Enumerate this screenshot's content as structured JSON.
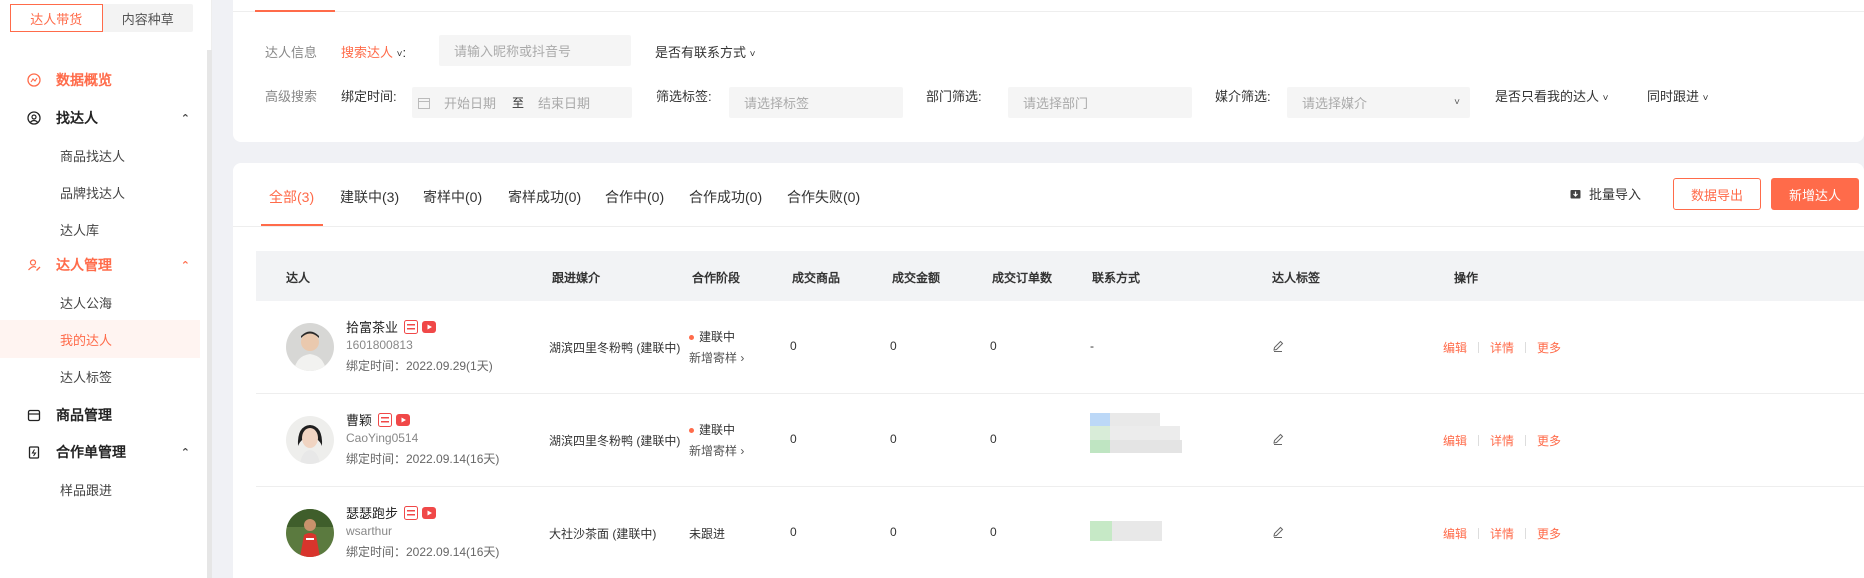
{
  "sidebar": {
    "top_tabs": [
      "达人带货",
      "内容种草"
    ],
    "groups": [
      {
        "label": "数据概览"
      },
      {
        "label": "找达人",
        "items": [
          "商品找达人",
          "品牌找达人",
          "达人库"
        ]
      },
      {
        "label": "达人管理",
        "items": [
          "达人公海",
          "我的达人",
          "达人标签"
        ]
      },
      {
        "label": "商品管理"
      },
      {
        "label": "合作单管理",
        "items": [
          "样品跟进"
        ]
      }
    ]
  },
  "filters": {
    "row1": {
      "label": "达人信息",
      "search_type": "搜索达人",
      "search_placeholder": "请输入昵称或抖音号",
      "contact_dropdown": "是否有联系方式"
    },
    "row2": {
      "label": "高级搜索",
      "bind_time_label": "绑定时间:",
      "start_placeholder": "开始日期",
      "range_sep": "至",
      "end_placeholder": "结束日期",
      "tag_label": "筛选标签:",
      "tag_placeholder": "请选择标签",
      "dept_label": "部门筛选:",
      "dept_placeholder": "请选择部门",
      "media_label": "媒介筛选:",
      "media_placeholder": "请选择媒介",
      "mine_dropdown": "是否只看我的达人",
      "sync_dropdown": "同时跟进"
    }
  },
  "status_tabs": [
    "全部(3)",
    "建联中(3)",
    "寄样中(0)",
    "寄样成功(0)",
    "合作中(0)",
    "合作成功(0)",
    "合作失败(0)"
  ],
  "actions": {
    "import": "批量导入",
    "export": "数据导出",
    "add": "新增达人"
  },
  "table": {
    "headers": [
      "达人",
      "跟进媒介",
      "合作阶段",
      "成交商品",
      "成交金额",
      "成交订单数",
      "联系方式",
      "达人标签",
      "操作"
    ],
    "rows": [
      {
        "name": "拾富茶业",
        "handle": "1601800813",
        "bind_time": "绑定时间：2022.09.29(1天)",
        "media": "湖滨四里冬粉鸭 (建联中)",
        "stage": "建联中",
        "stage_action": "新增寄样 ›",
        "goods": "0",
        "amount": "0",
        "orders": "0",
        "contact": "-"
      },
      {
        "name": "曹颖",
        "handle": "CaoYing0514",
        "bind_time": "绑定时间：2022.09.14(16天)",
        "media": "湖滨四里冬粉鸭 (建联中)",
        "stage": "建联中",
        "stage_action": "新增寄样 ›",
        "goods": "0",
        "amount": "0",
        "orders": "0",
        "contact": ""
      },
      {
        "name": "瑟瑟跑步",
        "handle": "wsarthur",
        "bind_time": "绑定时间：2022.09.14(16天)",
        "media": "大社沙茶面 (建联中)",
        "stage": "未跟进",
        "stage_action": "",
        "goods": "0",
        "amount": "0",
        "orders": "0",
        "contact": ""
      }
    ],
    "ops": [
      "编辑",
      "详情",
      "更多"
    ]
  },
  "colors": {
    "accent": "#ff6b4a"
  }
}
